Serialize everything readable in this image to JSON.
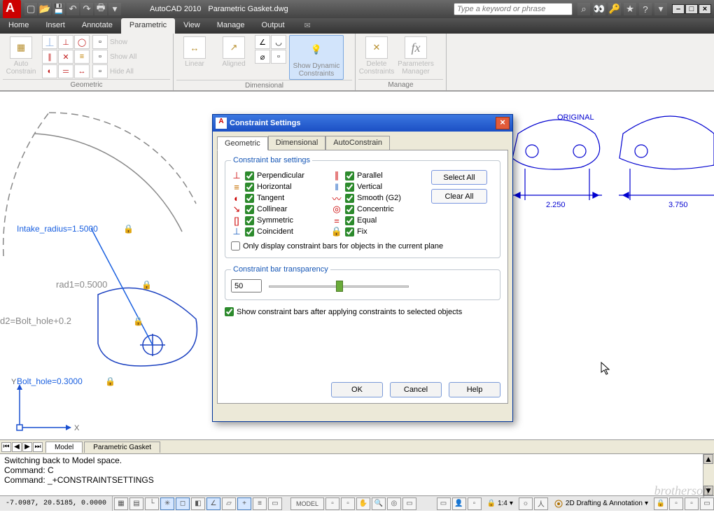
{
  "app": {
    "name": "AutoCAD 2010",
    "document": "Parametric Gasket.dwg"
  },
  "search": {
    "placeholder": "Type a keyword or phrase"
  },
  "menu": {
    "tabs": [
      "Home",
      "Insert",
      "Annotate",
      "Parametric",
      "View",
      "Manage",
      "Output"
    ],
    "active": "Parametric"
  },
  "ribbon": {
    "panels": [
      {
        "name": "Geometric",
        "big": "Auto\nConstrain",
        "side": [
          "Show",
          "Show All",
          "Hide All"
        ]
      },
      {
        "name": "Dimensional",
        "items": [
          "Linear",
          "Aligned",
          "",
          "Show Dynamic\nConstraints"
        ]
      },
      {
        "name": "Manage",
        "items": [
          "Delete\nConstraints",
          "Parameters\nManager"
        ]
      }
    ],
    "highlighted": "Show Dynamic\nConstraints"
  },
  "canvas": {
    "label_original": "ORIGINAL",
    "dim1": "2.250",
    "dim2": "3.750",
    "param1": "Intake_radius=1.5000",
    "param2": "rad1=0.5000",
    "param3": "d2=Bolt_hole+0.2",
    "param4": "Bolt_hole=0.3000",
    "x": "X",
    "y": "Y"
  },
  "modeltabs": {
    "a": "Model",
    "b": "Parametric Gasket"
  },
  "cmd": {
    "l1": "Switching back to Model space.",
    "l2": "Command: C",
    "l3": "Command: _+CONSTRAINTSETTINGS"
  },
  "status": {
    "coords": "-7.0987, 20.5185, 0.0000",
    "model": "MODEL",
    "scale": "1:4",
    "workspace": "2D Drafting & Annotation"
  },
  "dialog": {
    "title": "Constraint Settings",
    "tabs": [
      "Geometric",
      "Dimensional",
      "AutoConstrain"
    ],
    "active": "Geometric",
    "group1": "Constraint bar settings",
    "select_all": "Select All",
    "clear_all": "Clear All",
    "constraints_left": [
      "Perpendicular",
      "Horizontal",
      "Tangent",
      "Collinear",
      "Symmetric",
      "Coincident"
    ],
    "constraints_right": [
      "Parallel",
      "Vertical",
      "Smooth (G2)",
      "Concentric",
      "Equal",
      "Fix"
    ],
    "plane_only": "Only display constraint bars for objects in the current plane",
    "group2": "Constraint bar transparency",
    "transparency": "50",
    "after": "Show constraint bars after applying constraints to selected objects",
    "ok": "OK",
    "cancel": "Cancel",
    "help": "Help"
  },
  "watermark": "brothersoft"
}
